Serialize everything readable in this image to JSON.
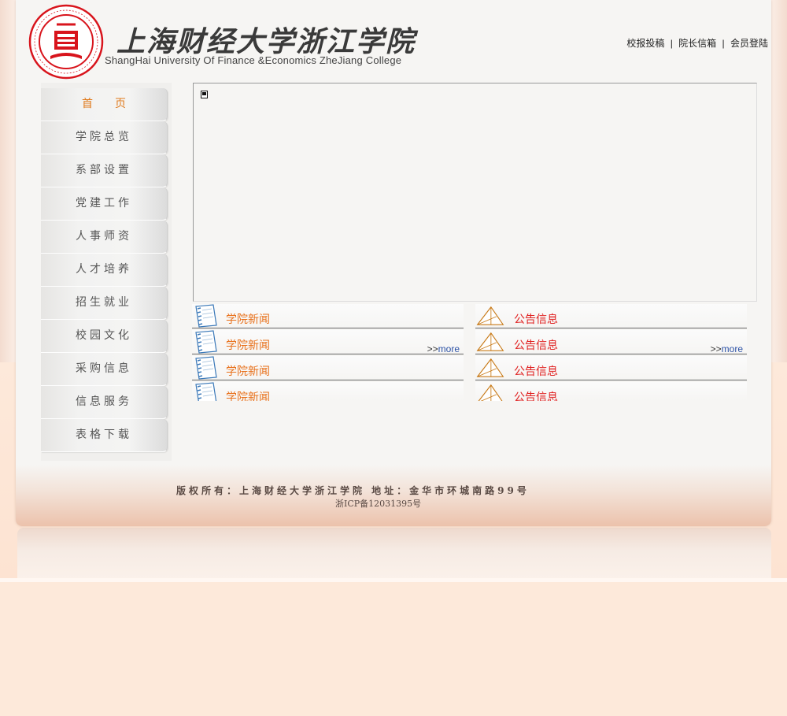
{
  "header": {
    "title_cn": "上海财经大学浙江学院",
    "title_en": "ShangHai  University Of Finance &Economics ZheJiang College",
    "links": [
      "校报投稿",
      "院长信箱",
      "会员登陆"
    ],
    "separator": "|"
  },
  "nav": {
    "items": [
      {
        "label": "首页"
      },
      {
        "label": "学院总览"
      },
      {
        "label": "系部设置"
      },
      {
        "label": "党建工作"
      },
      {
        "label": "人事师资"
      },
      {
        "label": "人才培养"
      },
      {
        "label": "招生就业"
      },
      {
        "label": "校园文化"
      },
      {
        "label": "采购信息"
      },
      {
        "label": "信息服务"
      },
      {
        "label": "表格下载"
      }
    ],
    "active_index": 0
  },
  "news": {
    "left_label": "学院新闻",
    "right_label": "公告信息",
    "more_prefix": ">>",
    "more_text": "more",
    "rows": 4
  },
  "footer": {
    "copyright": "版权所有：上海财经大学浙江学院   地址：金华市环城南路99号",
    "icp": "浙ICP备12031395号"
  },
  "colors": {
    "accent_orange": "#e07b1e",
    "announce_red": "#e02020",
    "more_blue": "#2c52a6"
  },
  "icons": {
    "logo": "university-seal-icon",
    "news": "notebook-icon",
    "announce": "folded-note-icon",
    "flash": "flash-placeholder-icon"
  }
}
